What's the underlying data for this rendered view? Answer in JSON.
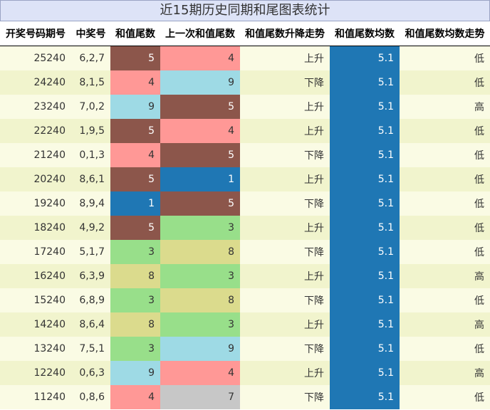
{
  "title": "近15期历史同期和尾图表统计",
  "headers": [
    "开奖号码期号",
    "中奖号",
    "和值尾数",
    "上一次和值尾数",
    "和值尾数升降走势",
    "和值尾数均数",
    "和值尾数均数走势"
  ],
  "rows": [
    {
      "issue": "25240",
      "number": "6,2,7",
      "tail": "5",
      "prev_tail": "4",
      "trend": "上升",
      "avg": "5.1",
      "avg_trend": "低"
    },
    {
      "issue": "24240",
      "number": "8,1,5",
      "tail": "4",
      "prev_tail": "9",
      "trend": "下降",
      "avg": "5.1",
      "avg_trend": "低"
    },
    {
      "issue": "23240",
      "number": "7,0,2",
      "tail": "9",
      "prev_tail": "5",
      "trend": "上升",
      "avg": "5.1",
      "avg_trend": "高"
    },
    {
      "issue": "22240",
      "number": "1,9,5",
      "tail": "5",
      "prev_tail": "4",
      "trend": "上升",
      "avg": "5.1",
      "avg_trend": "低"
    },
    {
      "issue": "21240",
      "number": "0,1,3",
      "tail": "4",
      "prev_tail": "5",
      "trend": "下降",
      "avg": "5.1",
      "avg_trend": "低"
    },
    {
      "issue": "20240",
      "number": "8,6,1",
      "tail": "5",
      "prev_tail": "1",
      "trend": "上升",
      "avg": "5.1",
      "avg_trend": "低"
    },
    {
      "issue": "19240",
      "number": "8,9,4",
      "tail": "1",
      "prev_tail": "5",
      "trend": "下降",
      "avg": "5.1",
      "avg_trend": "低"
    },
    {
      "issue": "18240",
      "number": "4,9,2",
      "tail": "5",
      "prev_tail": "3",
      "trend": "上升",
      "avg": "5.1",
      "avg_trend": "低"
    },
    {
      "issue": "17240",
      "number": "5,1,7",
      "tail": "3",
      "prev_tail": "8",
      "trend": "下降",
      "avg": "5.1",
      "avg_trend": "低"
    },
    {
      "issue": "16240",
      "number": "6,3,9",
      "tail": "8",
      "prev_tail": "3",
      "trend": "上升",
      "avg": "5.1",
      "avg_trend": "高"
    },
    {
      "issue": "15240",
      "number": "6,8,9",
      "tail": "3",
      "prev_tail": "8",
      "trend": "下降",
      "avg": "5.1",
      "avg_trend": "低"
    },
    {
      "issue": "14240",
      "number": "8,6,4",
      "tail": "8",
      "prev_tail": "3",
      "trend": "上升",
      "avg": "5.1",
      "avg_trend": "高"
    },
    {
      "issue": "13240",
      "number": "7,5,1",
      "tail": "3",
      "prev_tail": "9",
      "trend": "下降",
      "avg": "5.1",
      "avg_trend": "低"
    },
    {
      "issue": "12240",
      "number": "0,6,3",
      "tail": "9",
      "prev_tail": "4",
      "trend": "上升",
      "avg": "5.1",
      "avg_trend": "高"
    },
    {
      "issue": "11240",
      "number": "0,8,6",
      "tail": "4",
      "prev_tail": "7",
      "trend": "下降",
      "avg": "5.1",
      "avg_trend": "低"
    }
  ],
  "digit_colors": {
    "1": "#1f77b4",
    "3": "#98df8a",
    "4": "#ff9896",
    "5": "#8c564b",
    "7": "#c7c7c7",
    "8": "#dbdb8d",
    "9": "#9edae5"
  },
  "avg_color": "#1f77b4"
}
